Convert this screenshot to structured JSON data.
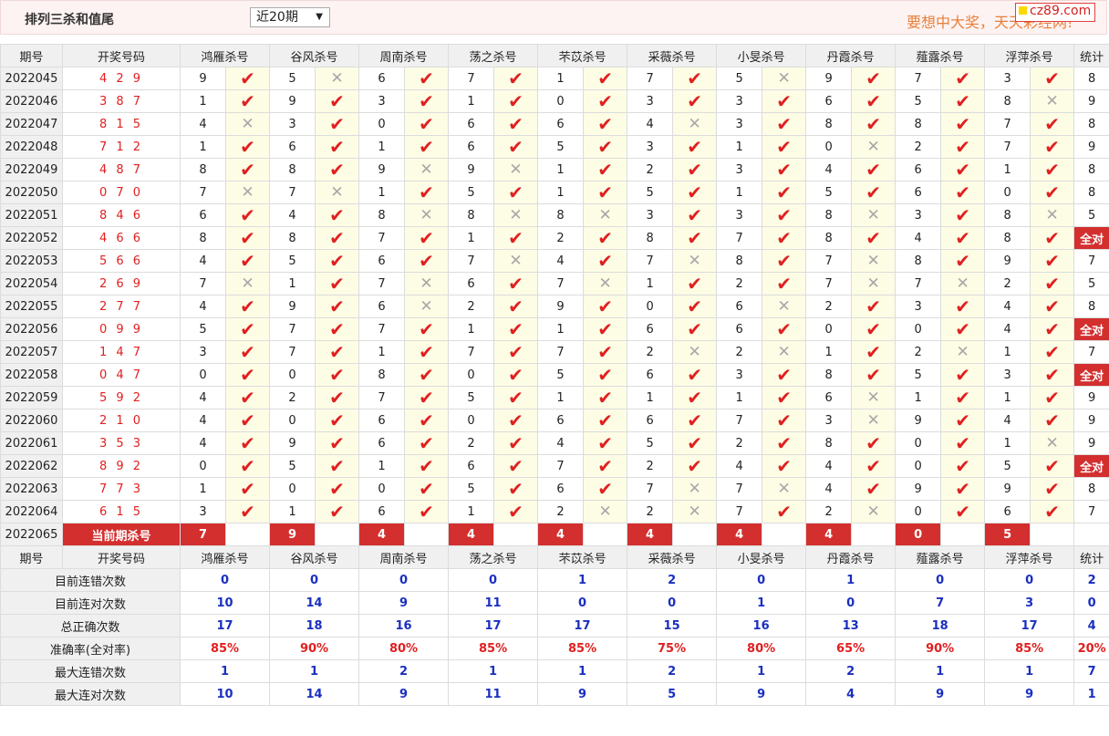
{
  "page": {
    "title": "排列三杀和值尾",
    "select_value": "近20期",
    "slogan": "要想中大奖，天天彩经网!",
    "logo": "cz89.com"
  },
  "columns": {
    "issue": "期号",
    "draw": "开奖号码",
    "experts": [
      "鸿雁杀号",
      "谷风杀号",
      "周南杀号",
      "荡之杀号",
      "芣苡杀号",
      "采薇杀号",
      "小旻杀号",
      "丹霞杀号",
      "薤露杀号",
      "浮萍杀号"
    ],
    "stat": "统计"
  },
  "rows": [
    {
      "issue": "2022045",
      "draw": "4 2 9",
      "kills": [
        "9",
        "5",
        "6",
        "7",
        "1",
        "7",
        "5",
        "9",
        "7",
        "3"
      ],
      "marks": [
        1,
        0,
        1,
        1,
        1,
        1,
        0,
        1,
        1,
        1
      ],
      "stat": "8"
    },
    {
      "issue": "2022046",
      "draw": "3 8 7",
      "kills": [
        "1",
        "9",
        "3",
        "1",
        "0",
        "3",
        "3",
        "6",
        "5",
        "8"
      ],
      "marks": [
        1,
        1,
        1,
        1,
        1,
        1,
        1,
        1,
        1,
        0
      ],
      "stat": "9"
    },
    {
      "issue": "2022047",
      "draw": "8 1 5",
      "kills": [
        "4",
        "3",
        "0",
        "6",
        "6",
        "4",
        "3",
        "8",
        "8",
        "7"
      ],
      "marks": [
        0,
        1,
        1,
        1,
        1,
        0,
        1,
        1,
        1,
        1
      ],
      "stat": "8"
    },
    {
      "issue": "2022048",
      "draw": "7 1 2",
      "kills": [
        "1",
        "6",
        "1",
        "6",
        "5",
        "3",
        "1",
        "0",
        "2",
        "7"
      ],
      "marks": [
        1,
        1,
        1,
        1,
        1,
        1,
        1,
        0,
        1,
        1
      ],
      "stat": "9"
    },
    {
      "issue": "2022049",
      "draw": "4 8 7",
      "kills": [
        "8",
        "8",
        "9",
        "9",
        "1",
        "2",
        "3",
        "4",
        "6",
        "1"
      ],
      "marks": [
        1,
        1,
        0,
        0,
        1,
        1,
        1,
        1,
        1,
        1
      ],
      "stat": "8"
    },
    {
      "issue": "2022050",
      "draw": "0 7 0",
      "kills": [
        "7",
        "7",
        "1",
        "5",
        "1",
        "5",
        "1",
        "5",
        "6",
        "0"
      ],
      "marks": [
        0,
        0,
        1,
        1,
        1,
        1,
        1,
        1,
        1,
        1
      ],
      "stat": "8"
    },
    {
      "issue": "2022051",
      "draw": "8 4 6",
      "kills": [
        "6",
        "4",
        "8",
        "8",
        "8",
        "3",
        "3",
        "8",
        "3",
        "8"
      ],
      "marks": [
        1,
        1,
        0,
        0,
        0,
        1,
        1,
        0,
        1,
        0
      ],
      "stat": "5"
    },
    {
      "issue": "2022052",
      "draw": "4 6 6",
      "kills": [
        "8",
        "8",
        "7",
        "1",
        "2",
        "8",
        "7",
        "8",
        "4",
        "8"
      ],
      "marks": [
        1,
        1,
        1,
        1,
        1,
        1,
        1,
        1,
        1,
        1
      ],
      "stat": "全对"
    },
    {
      "issue": "2022053",
      "draw": "5 6 6",
      "kills": [
        "4",
        "5",
        "6",
        "7",
        "4",
        "7",
        "8",
        "7",
        "8",
        "9"
      ],
      "marks": [
        1,
        1,
        1,
        0,
        1,
        0,
        1,
        0,
        1,
        1
      ],
      "stat": "7"
    },
    {
      "issue": "2022054",
      "draw": "2 6 9",
      "kills": [
        "7",
        "1",
        "7",
        "6",
        "7",
        "1",
        "2",
        "7",
        "7",
        "2"
      ],
      "marks": [
        0,
        1,
        0,
        1,
        0,
        1,
        1,
        0,
        0,
        1
      ],
      "stat": "5"
    },
    {
      "issue": "2022055",
      "draw": "2 7 7",
      "kills": [
        "4",
        "9",
        "6",
        "2",
        "9",
        "0",
        "6",
        "2",
        "3",
        "4"
      ],
      "marks": [
        1,
        1,
        0,
        1,
        1,
        1,
        0,
        1,
        1,
        1
      ],
      "stat": "8"
    },
    {
      "issue": "2022056",
      "draw": "0 9 9",
      "kills": [
        "5",
        "7",
        "7",
        "1",
        "1",
        "6",
        "6",
        "0",
        "0",
        "4"
      ],
      "marks": [
        1,
        1,
        1,
        1,
        1,
        1,
        1,
        1,
        1,
        1
      ],
      "stat": "全对"
    },
    {
      "issue": "2022057",
      "draw": "1 4 7",
      "kills": [
        "3",
        "7",
        "1",
        "7",
        "7",
        "2",
        "2",
        "1",
        "2",
        "1"
      ],
      "marks": [
        1,
        1,
        1,
        1,
        1,
        0,
        0,
        1,
        0,
        1
      ],
      "stat": "7"
    },
    {
      "issue": "2022058",
      "draw": "0 4 7",
      "kills": [
        "0",
        "0",
        "8",
        "0",
        "5",
        "6",
        "3",
        "8",
        "5",
        "3"
      ],
      "marks": [
        1,
        1,
        1,
        1,
        1,
        1,
        1,
        1,
        1,
        1
      ],
      "stat": "全对"
    },
    {
      "issue": "2022059",
      "draw": "5 9 2",
      "kills": [
        "4",
        "2",
        "7",
        "5",
        "1",
        "1",
        "1",
        "6",
        "1",
        "1"
      ],
      "marks": [
        1,
        1,
        1,
        1,
        1,
        1,
        1,
        0,
        1,
        1
      ],
      "stat": "9"
    },
    {
      "issue": "2022060",
      "draw": "2 1 0",
      "kills": [
        "4",
        "0",
        "6",
        "0",
        "6",
        "6",
        "7",
        "3",
        "9",
        "4"
      ],
      "marks": [
        1,
        1,
        1,
        1,
        1,
        1,
        1,
        0,
        1,
        1
      ],
      "stat": "9"
    },
    {
      "issue": "2022061",
      "draw": "3 5 3",
      "kills": [
        "4",
        "9",
        "6",
        "2",
        "4",
        "5",
        "2",
        "8",
        "0",
        "1"
      ],
      "marks": [
        1,
        1,
        1,
        1,
        1,
        1,
        1,
        1,
        1,
        0
      ],
      "stat": "9"
    },
    {
      "issue": "2022062",
      "draw": "8 9 2",
      "kills": [
        "0",
        "5",
        "1",
        "6",
        "7",
        "2",
        "4",
        "4",
        "0",
        "5"
      ],
      "marks": [
        1,
        1,
        1,
        1,
        1,
        1,
        1,
        1,
        1,
        1
      ],
      "stat": "全对"
    },
    {
      "issue": "2022063",
      "draw": "7 7 3",
      "kills": [
        "1",
        "0",
        "0",
        "5",
        "6",
        "7",
        "7",
        "4",
        "9",
        "9"
      ],
      "marks": [
        1,
        1,
        1,
        1,
        1,
        0,
        0,
        1,
        1,
        1
      ],
      "stat": "8"
    },
    {
      "issue": "2022064",
      "draw": "6 1 5",
      "kills": [
        "3",
        "1",
        "6",
        "1",
        "2",
        "2",
        "7",
        "2",
        "0",
        "6"
      ],
      "marks": [
        1,
        1,
        1,
        1,
        0,
        0,
        1,
        0,
        1,
        1
      ],
      "stat": "7"
    }
  ],
  "current": {
    "issue": "2022065",
    "label": "当前期杀号",
    "kills": [
      "7",
      "9",
      "4",
      "4",
      "4",
      "4",
      "4",
      "4",
      "0",
      "5"
    ]
  },
  "stats": [
    {
      "label": "目前连错次数",
      "values": [
        "0",
        "0",
        "0",
        "0",
        "1",
        "2",
        "0",
        "1",
        "0",
        "0"
      ],
      "stat": "2",
      "style": "blue"
    },
    {
      "label": "目前连对次数",
      "values": [
        "10",
        "14",
        "9",
        "11",
        "0",
        "0",
        "1",
        "0",
        "7",
        "3"
      ],
      "stat": "0",
      "style": "blue"
    },
    {
      "label": "总正确次数",
      "values": [
        "17",
        "18",
        "16",
        "17",
        "17",
        "15",
        "16",
        "13",
        "18",
        "17"
      ],
      "stat": "4",
      "style": "blue"
    },
    {
      "label": "准确率(全对率)",
      "values": [
        "85%",
        "90%",
        "80%",
        "85%",
        "85%",
        "75%",
        "80%",
        "65%",
        "90%",
        "85%"
      ],
      "stat": "20%",
      "style": "red"
    },
    {
      "label": "最大连错次数",
      "values": [
        "1",
        "1",
        "2",
        "1",
        "1",
        "2",
        "1",
        "2",
        "1",
        "1"
      ],
      "stat": "7",
      "style": "blue"
    },
    {
      "label": "最大连对次数",
      "values": [
        "10",
        "14",
        "9",
        "11",
        "9",
        "5",
        "9",
        "4",
        "9",
        "9"
      ],
      "stat": "1",
      "style": "blue"
    }
  ],
  "symbols": {
    "correct": "✔",
    "wrong": "✕"
  },
  "colors": {
    "correct": "#e02020",
    "wrong": "#a8a8a8",
    "highlight": "#d32f2f",
    "stat_blue": "#1a2fc0",
    "mark_bg": "#fdfce5"
  }
}
